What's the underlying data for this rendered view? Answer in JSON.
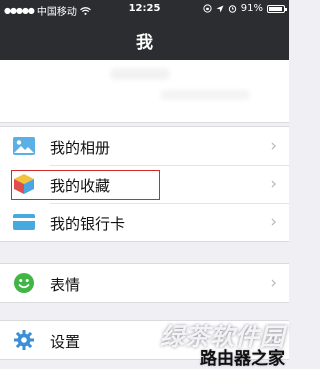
{
  "status_bar": {
    "carrier": "中国移动",
    "time": "12:25",
    "battery": "91%",
    "battery_level": 0.91
  },
  "nav": {
    "title": "我"
  },
  "menu_groups": [
    {
      "items": [
        {
          "label": "我的相册",
          "icon": "photo-album-icon",
          "color": "#5ab0e5"
        },
        {
          "label": "我的收藏",
          "icon": "favorites-cube-icon",
          "color": "#e24c4c"
        },
        {
          "label": "我的银行卡",
          "icon": "bank-card-icon",
          "color": "#46a9e0"
        }
      ]
    },
    {
      "items": [
        {
          "label": "表情",
          "icon": "emoji-smiley-icon",
          "color": "#41b545"
        }
      ]
    },
    {
      "items": [
        {
          "label": "设置",
          "icon": "settings-gear-icon",
          "color": "#3a8fd6"
        }
      ]
    }
  ],
  "watermark": {
    "line1": "绿茶软件园",
    "line2": "路由器之家"
  },
  "colors": {
    "top_bar": "#2b2d31",
    "highlight": "#d12a2a",
    "background": "#efeff4"
  }
}
